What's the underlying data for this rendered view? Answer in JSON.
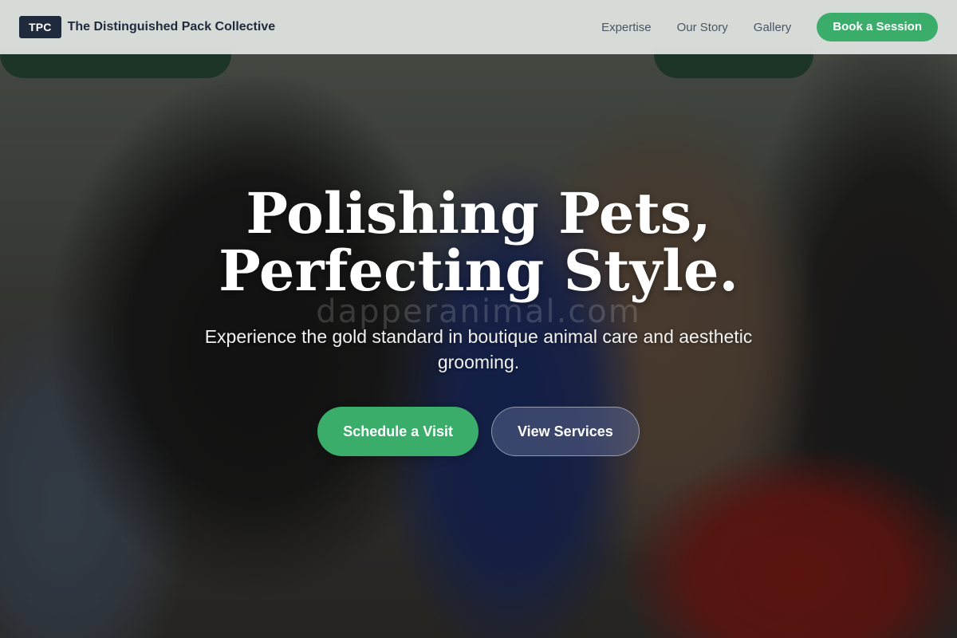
{
  "navbar": {
    "logo_badge": "TPC",
    "brand_name": "The Distinguished Pack Collective",
    "links": [
      "Expertise",
      "Our Story",
      "Gallery"
    ],
    "cta_label": "Book a Session"
  },
  "hero": {
    "title": "Polishing Pets, Perfecting Style.",
    "subtitle": "Experience the gold standard in boutique animal care and aesthetic grooming.",
    "primary_button": "Schedule a Visit",
    "secondary_button": "View Services",
    "watermark": "dapperanimal.com"
  },
  "colors": {
    "accent_green": "#3aad6b",
    "navy": "#1f2a3c",
    "nav_background": "#e2e6e4"
  }
}
